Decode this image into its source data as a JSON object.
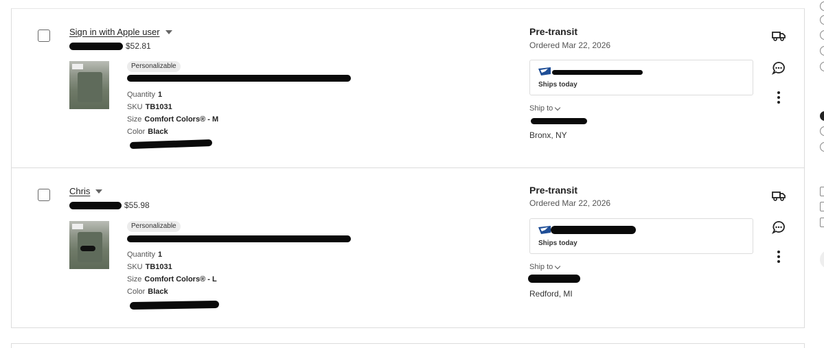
{
  "orders": [
    {
      "buyer": "Sign in with Apple user",
      "price": "$52.81",
      "badge": "Personalizable",
      "quantity_label": "Quantity",
      "quantity": "1",
      "sku_label": "SKU",
      "sku": "TB1031",
      "size_label": "Size",
      "size": "Comfort Colors® - M",
      "color_label": "Color",
      "color": "Black",
      "status": "Pre-transit",
      "ordered": "Ordered Mar 22, 2026",
      "ships_today": "Ships today",
      "ship_to_label": "Ship to",
      "city": "Bronx, NY"
    },
    {
      "buyer": "Chris",
      "price": "$55.98",
      "badge": "Personalizable",
      "quantity_label": "Quantity",
      "quantity": "1",
      "sku_label": "SKU",
      "sku": "TB1031",
      "size_label": "Size",
      "size": "Comfort Colors® - L",
      "color_label": "Color",
      "color": "Black",
      "status": "Pre-transit",
      "ordered": "Ordered Mar 22, 2026",
      "ships_today": "Ships today",
      "ship_to_label": "Ship to",
      "city": "Redford, MI"
    }
  ],
  "icons": {
    "truck": "truck-icon",
    "message": "message-icon",
    "more": "more-vertical-icon",
    "usps": "usps-eagle-icon"
  },
  "colors": {
    "border": "#dcdcdc",
    "badge_bg": "#ececec",
    "text": "#222222",
    "muted": "#555555",
    "redaction": "#0a0a0a"
  }
}
